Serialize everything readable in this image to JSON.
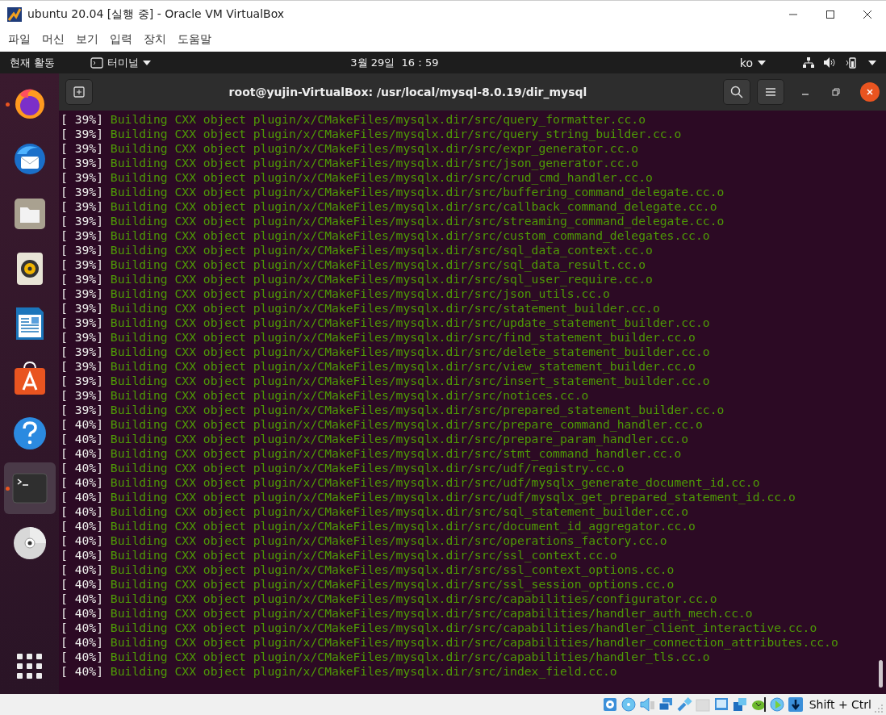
{
  "window": {
    "title": "ubuntu 20.04 [실행 중] - Oracle VM VirtualBox"
  },
  "menu": [
    "파일",
    "머신",
    "보기",
    "입력",
    "장치",
    "도움말"
  ],
  "top_bar": {
    "activities": "현재 활동",
    "app_menu": "터미널",
    "clock": "3월 29일  16：59",
    "input_method": "ko"
  },
  "dock": {
    "items": [
      {
        "kind": "firefox",
        "running": true,
        "selected": false
      },
      {
        "kind": "mail",
        "running": false,
        "selected": false
      },
      {
        "kind": "files",
        "running": false,
        "selected": false
      },
      {
        "kind": "music",
        "running": false,
        "selected": false
      },
      {
        "kind": "writer",
        "running": false,
        "selected": false
      },
      {
        "kind": "store",
        "running": false,
        "selected": false
      },
      {
        "kind": "help",
        "running": false,
        "selected": false
      },
      {
        "kind": "terminal",
        "running": true,
        "selected": true
      },
      {
        "kind": "disc",
        "running": false,
        "selected": false
      }
    ]
  },
  "terminal": {
    "title": "root@yujin-VirtualBox: /usr/local/mysql-8.0.19/dir_mysql",
    "lines": [
      {
        "progress": "[ 39%]",
        "message": "Building CXX object plugin/x/CMakeFiles/mysqlx.dir/src/query_formatter.cc.o"
      },
      {
        "progress": "[ 39%]",
        "message": "Building CXX object plugin/x/CMakeFiles/mysqlx.dir/src/query_string_builder.cc.o"
      },
      {
        "progress": "[ 39%]",
        "message": "Building CXX object plugin/x/CMakeFiles/mysqlx.dir/src/expr_generator.cc.o"
      },
      {
        "progress": "[ 39%]",
        "message": "Building CXX object plugin/x/CMakeFiles/mysqlx.dir/src/json_generator.cc.o"
      },
      {
        "progress": "[ 39%]",
        "message": "Building CXX object plugin/x/CMakeFiles/mysqlx.dir/src/crud_cmd_handler.cc.o"
      },
      {
        "progress": "[ 39%]",
        "message": "Building CXX object plugin/x/CMakeFiles/mysqlx.dir/src/buffering_command_delegate.cc.o"
      },
      {
        "progress": "[ 39%]",
        "message": "Building CXX object plugin/x/CMakeFiles/mysqlx.dir/src/callback_command_delegate.cc.o"
      },
      {
        "progress": "[ 39%]",
        "message": "Building CXX object plugin/x/CMakeFiles/mysqlx.dir/src/streaming_command_delegate.cc.o"
      },
      {
        "progress": "[ 39%]",
        "message": "Building CXX object plugin/x/CMakeFiles/mysqlx.dir/src/custom_command_delegates.cc.o"
      },
      {
        "progress": "[ 39%]",
        "message": "Building CXX object plugin/x/CMakeFiles/mysqlx.dir/src/sql_data_context.cc.o"
      },
      {
        "progress": "[ 39%]",
        "message": "Building CXX object plugin/x/CMakeFiles/mysqlx.dir/src/sql_data_result.cc.o"
      },
      {
        "progress": "[ 39%]",
        "message": "Building CXX object plugin/x/CMakeFiles/mysqlx.dir/src/sql_user_require.cc.o"
      },
      {
        "progress": "[ 39%]",
        "message": "Building CXX object plugin/x/CMakeFiles/mysqlx.dir/src/json_utils.cc.o"
      },
      {
        "progress": "[ 39%]",
        "message": "Building CXX object plugin/x/CMakeFiles/mysqlx.dir/src/statement_builder.cc.o"
      },
      {
        "progress": "[ 39%]",
        "message": "Building CXX object plugin/x/CMakeFiles/mysqlx.dir/src/update_statement_builder.cc.o"
      },
      {
        "progress": "[ 39%]",
        "message": "Building CXX object plugin/x/CMakeFiles/mysqlx.dir/src/find_statement_builder.cc.o"
      },
      {
        "progress": "[ 39%]",
        "message": "Building CXX object plugin/x/CMakeFiles/mysqlx.dir/src/delete_statement_builder.cc.o"
      },
      {
        "progress": "[ 39%]",
        "message": "Building CXX object plugin/x/CMakeFiles/mysqlx.dir/src/view_statement_builder.cc.o"
      },
      {
        "progress": "[ 39%]",
        "message": "Building CXX object plugin/x/CMakeFiles/mysqlx.dir/src/insert_statement_builder.cc.o"
      },
      {
        "progress": "[ 39%]",
        "message": "Building CXX object plugin/x/CMakeFiles/mysqlx.dir/src/notices.cc.o"
      },
      {
        "progress": "[ 39%]",
        "message": "Building CXX object plugin/x/CMakeFiles/mysqlx.dir/src/prepared_statement_builder.cc.o"
      },
      {
        "progress": "[ 40%]",
        "message": "Building CXX object plugin/x/CMakeFiles/mysqlx.dir/src/prepare_command_handler.cc.o"
      },
      {
        "progress": "[ 40%]",
        "message": "Building CXX object plugin/x/CMakeFiles/mysqlx.dir/src/prepare_param_handler.cc.o"
      },
      {
        "progress": "[ 40%]",
        "message": "Building CXX object plugin/x/CMakeFiles/mysqlx.dir/src/stmt_command_handler.cc.o"
      },
      {
        "progress": "[ 40%]",
        "message": "Building CXX object plugin/x/CMakeFiles/mysqlx.dir/src/udf/registry.cc.o"
      },
      {
        "progress": "[ 40%]",
        "message": "Building CXX object plugin/x/CMakeFiles/mysqlx.dir/src/udf/mysqlx_generate_document_id.cc.o"
      },
      {
        "progress": "[ 40%]",
        "message": "Building CXX object plugin/x/CMakeFiles/mysqlx.dir/src/udf/mysqlx_get_prepared_statement_id.cc.o"
      },
      {
        "progress": "[ 40%]",
        "message": "Building CXX object plugin/x/CMakeFiles/mysqlx.dir/src/sql_statement_builder.cc.o"
      },
      {
        "progress": "[ 40%]",
        "message": "Building CXX object plugin/x/CMakeFiles/mysqlx.dir/src/document_id_aggregator.cc.o"
      },
      {
        "progress": "[ 40%]",
        "message": "Building CXX object plugin/x/CMakeFiles/mysqlx.dir/src/operations_factory.cc.o"
      },
      {
        "progress": "[ 40%]",
        "message": "Building CXX object plugin/x/CMakeFiles/mysqlx.dir/src/ssl_context.cc.o"
      },
      {
        "progress": "[ 40%]",
        "message": "Building CXX object plugin/x/CMakeFiles/mysqlx.dir/src/ssl_context_options.cc.o"
      },
      {
        "progress": "[ 40%]",
        "message": "Building CXX object plugin/x/CMakeFiles/mysqlx.dir/src/ssl_session_options.cc.o"
      },
      {
        "progress": "[ 40%]",
        "message": "Building CXX object plugin/x/CMakeFiles/mysqlx.dir/src/capabilities/configurator.cc.o"
      },
      {
        "progress": "[ 40%]",
        "message": "Building CXX object plugin/x/CMakeFiles/mysqlx.dir/src/capabilities/handler_auth_mech.cc.o"
      },
      {
        "progress": "[ 40%]",
        "message": "Building CXX object plugin/x/CMakeFiles/mysqlx.dir/src/capabilities/handler_client_interactive.cc.o"
      },
      {
        "progress": "[ 40%]",
        "message": "Building CXX object plugin/x/CMakeFiles/mysqlx.dir/src/capabilities/handler_connection_attributes.cc.o"
      },
      {
        "progress": "[ 40%]",
        "message": "Building CXX object plugin/x/CMakeFiles/mysqlx.dir/src/capabilities/handler_tls.cc.o"
      },
      {
        "progress": "[ 40%]",
        "message": "Building CXX object plugin/x/CMakeFiles/mysqlx.dir/src/index_field.cc.o"
      }
    ]
  },
  "status_bar": {
    "host_key": "Shift + Ctrl"
  }
}
